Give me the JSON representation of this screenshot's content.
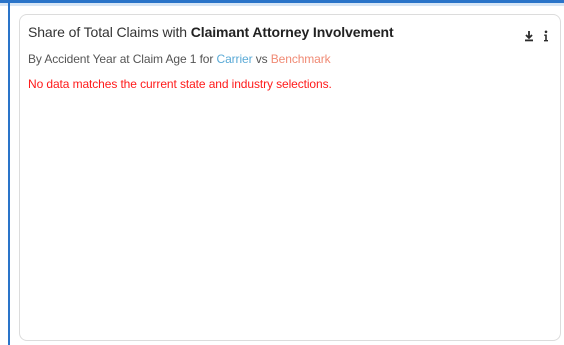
{
  "card": {
    "title_prefix": "Share of Total Claims with ",
    "title_emphasis": "Claimant Attorney Involvement",
    "subtitle_prefix": "By Accident Year at Claim Age 1 for ",
    "subtitle_carrier": "Carrier",
    "subtitle_vs": " vs ",
    "subtitle_benchmark": "Benchmark",
    "no_data_message": "No data matches the current state and industry selections.",
    "icons": {
      "download": "download-icon",
      "info": "info-icon"
    }
  },
  "colors": {
    "carrier": "#5aaad6",
    "benchmark": "#f08a74",
    "error": "#ff1a1a",
    "accent": "#2a74c9"
  }
}
